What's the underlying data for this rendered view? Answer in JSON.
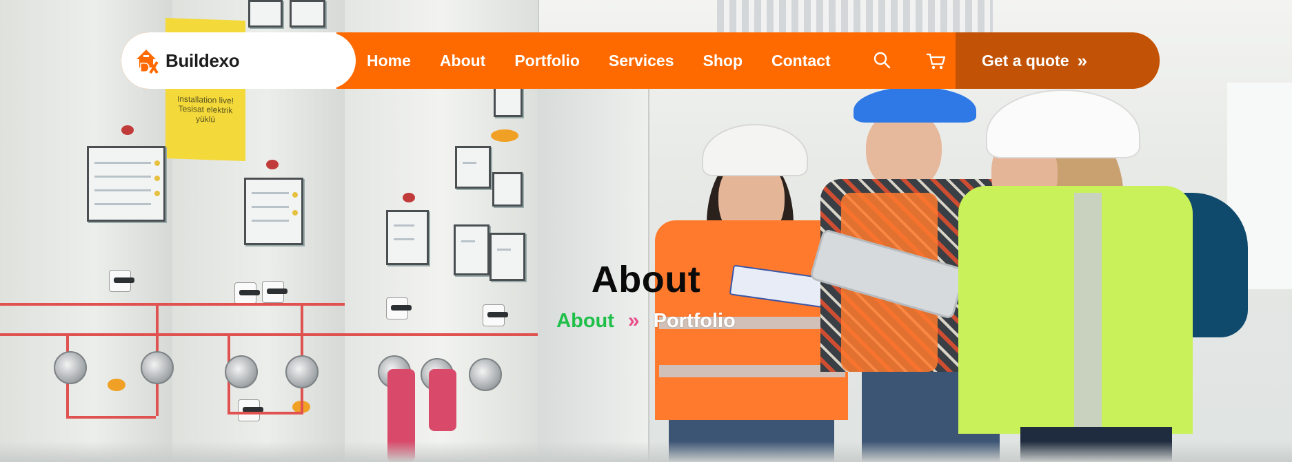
{
  "brand": {
    "name": "Buildexo",
    "logo_icon": "buildexo-logo-icon"
  },
  "nav": {
    "links": [
      "Home",
      "About",
      "Portfolio",
      "Services",
      "Shop",
      "Contact"
    ],
    "search_icon": "search-icon",
    "cart_icon": "cart-icon",
    "cta_label": "Get a quote",
    "cta_arrow": "»"
  },
  "hero": {
    "title": "About",
    "breadcrumb": {
      "link": "About",
      "separator": "»",
      "current": "Portfolio"
    },
    "sign_text": "Installation live! Tesisat elektrik yüklü"
  },
  "colors": {
    "nav_orange": "#ff6a00",
    "cta_dark_orange": "#c25205",
    "breadcrumb_link_green": "#1fbf4a",
    "breadcrumb_separator_pink": "#e84e8a"
  }
}
